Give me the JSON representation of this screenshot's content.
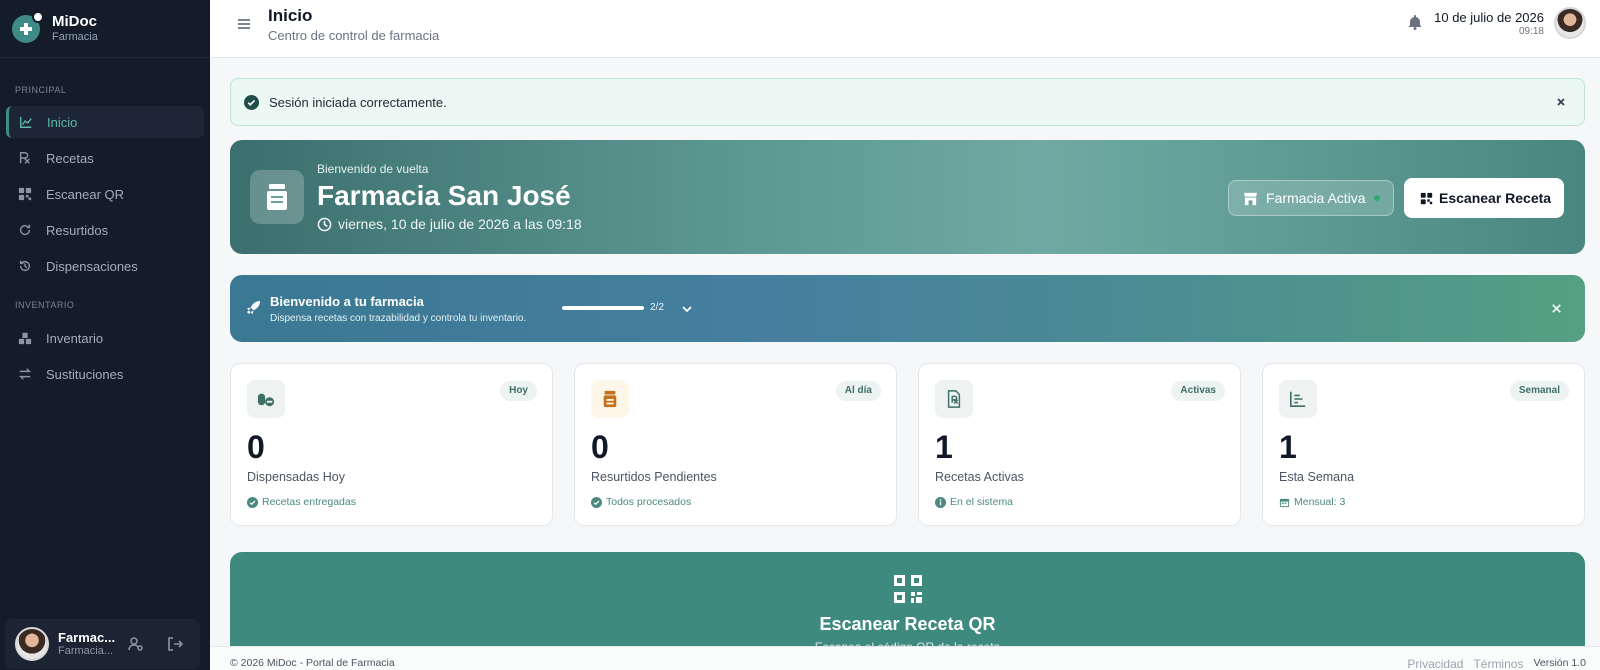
{
  "brand": {
    "name": "MiDoc",
    "subtitle": "Farmacia"
  },
  "sidebar": {
    "section_principal": "PRINCIPAL",
    "section_inventario": "INVENTARIO",
    "items": [
      {
        "label": "Inicio",
        "icon": "chart-line-icon"
      },
      {
        "label": "Recetas",
        "icon": "prescription-icon"
      },
      {
        "label": "Escanear QR",
        "icon": "qr-icon"
      },
      {
        "label": "Resurtidos",
        "icon": "refresh-icon"
      },
      {
        "label": "Dispensaciones",
        "icon": "history-icon"
      },
      {
        "label": "Inventario",
        "icon": "boxes-icon"
      },
      {
        "label": "Sustituciones",
        "icon": "swap-icon"
      }
    ],
    "user": {
      "name": "Farmac...",
      "role": "Farmacia..."
    }
  },
  "header": {
    "title": "Inicio",
    "subtitle": "Centro de control de farmacia",
    "date": "10 de julio de 2026",
    "time": "09:18"
  },
  "alert": {
    "message": "Sesión iniciada correctamente."
  },
  "hero": {
    "kicker": "Bienvenido de vuelta",
    "title": "Farmacia San José",
    "date": "viernes, 10 de julio de 2026 a las 09:18",
    "status_label": "Farmacia Activa",
    "scan_label": "Escanear Receta"
  },
  "onboarding": {
    "title": "Bienvenido a tu farmacia",
    "subtitle": "Dispensa recetas con trazabilidad y controla tu inventario.",
    "progress_text": "2/2",
    "progress_fraction": 1.0
  },
  "stats": [
    {
      "badge": "Hoy",
      "value": "0",
      "label": "Dispensadas Hoy",
      "foot": "Recetas entregadas",
      "icon": "pills-icon",
      "color": "#3f6f69",
      "bg": "#eef3f2"
    },
    {
      "badge": "Al día",
      "value": "0",
      "label": "Resurtidos Pendientes",
      "foot": "Todos procesados",
      "icon": "pill-bottle-icon",
      "color": "#c2721c",
      "bg": "#fef6e8"
    },
    {
      "badge": "Activas",
      "value": "1",
      "label": "Recetas Activas",
      "foot": "En el sistema",
      "icon": "prescription-file-icon",
      "color": "#3f6f69",
      "bg": "#eef3f2"
    },
    {
      "badge": "Semanal",
      "value": "1",
      "label": "Esta Semana",
      "foot": "Mensual: 3",
      "icon": "bar-chart-icon",
      "color": "#3f6f69",
      "bg": "#eef3f2"
    }
  ],
  "scan_section": {
    "title": "Escanear Receta QR",
    "subtitle": "Escanea el código QR de la receta"
  },
  "footer": {
    "copyright": "© 2026 MiDoc - Portal de Farmacia",
    "privacy": "Privacidad",
    "terms": "Términos",
    "version": "Versión 1.0"
  },
  "colors": {
    "sidebar_bg": "#141b29",
    "accent": "#3f8a7e",
    "accent_light": "#5fb9a6",
    "success": "#2faa6e"
  }
}
